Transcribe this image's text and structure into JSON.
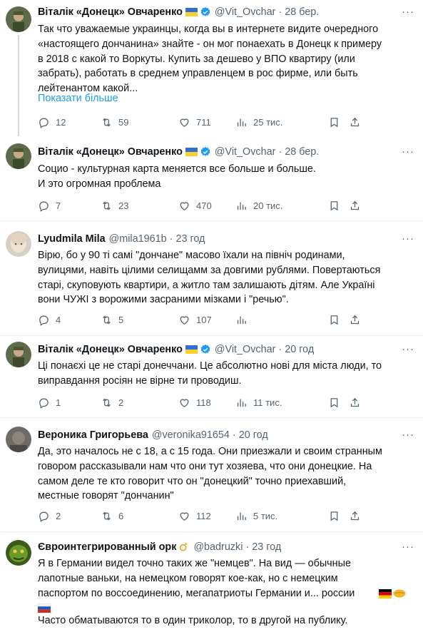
{
  "tweets": [
    {
      "name": "Віталік «Донецк» Овчаренко",
      "handle": "@Vit_Ovchar",
      "time": "28 бер.",
      "text": "Так что уважаемые украинцы, когда вы в интернете видите очередного\n«настоящего дончанина» знайте - он мог понаехать в Донецк к примеру\nв 2018 с какой то Воркуты. Купить за дешево у ВПО квартиру (или\nзабрать), работать в среднем управленцем в рос фирме, или быть\nлейтенантом какой...",
      "show_more": "Показати більше",
      "replies": "12",
      "retweets": "59",
      "likes": "711",
      "views": "25 тис."
    },
    {
      "name": "Віталік «Донецк» Овчаренко",
      "handle": "@Vit_Ovchar",
      "time": "28 бер.",
      "text": "Социо - культурная карта меняется все больше и больше.\nИ это огромная проблема",
      "replies": "7",
      "retweets": "23",
      "likes": "470",
      "views": "20 тис."
    },
    {
      "name": "Lyudmila Mila",
      "handle": "@mila1961b",
      "time": "23 год",
      "text": "Вірю, бо у 90 ті самі \"дончане\" масово їхали на північ родинами,\nвулицями, навіть цілими селищамм за довгими рублями. Повертаються\nстарі, скуповують квартири, а житло там залишають дітям. Але Україні\nвони ЧУЖІ з ворожими засраними мізками і \"речью\".",
      "replies": "4",
      "retweets": "5",
      "likes": "107",
      "views": ""
    },
    {
      "name": "Віталік «Донецк» Овчаренко",
      "handle": "@Vit_Ovchar",
      "time": "20 год",
      "text": "Ці понаєхі це не старі донеччани. Це абсолютно нові для міста люди, то\nвиправдання росіян не вірне ти проводиш.",
      "replies": "1",
      "retweets": "2",
      "likes": "118",
      "views": "11 тис."
    },
    {
      "name": "Вероника Григорьева",
      "handle": "@veronika91654",
      "time": "20 год",
      "text": "Да, это началось не с 18, а с 15 года. Они приезжали и своим странным\nговором рассказывали нам что они тут хозяева, что они донецкие. На\nсамом деле те кто говорит что он \"донецкий\" точно приехавший,\nместные говорят \"дончанин\"",
      "replies": "2",
      "retweets": "6",
      "likes": "112",
      "views": "5 тис."
    },
    {
      "name": "Євроинтегрированный орк",
      "handle": "@badruzki",
      "time": "23 год",
      "text": "Я в Германии видел точно таких же \"немцев\". На вид — обычные\nлапотные ваньки, на немецком говорят кое-как, но с немецким\nпаспортом по воссоединению, мегапатриоты Германии и... россии",
      "text2": "Часто обматываются то в один триколор, то в другой на публику."
    }
  ],
  "colors": {
    "accent": "#1d9bf0",
    "muted": "#536471",
    "text": "#0f1419",
    "verified": "#1d9bf0"
  }
}
